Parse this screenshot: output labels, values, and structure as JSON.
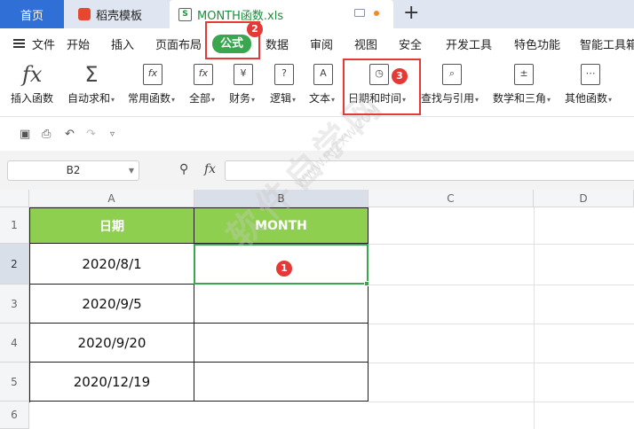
{
  "tabs": {
    "home": "首页",
    "template": "稻壳模板",
    "file": "MONTH函数.xls",
    "file_icon_letter": "S"
  },
  "menu": {
    "file": "文件",
    "items": [
      "开始",
      "插入",
      "页面布局",
      "公式",
      "数据",
      "审阅",
      "视图",
      "安全",
      "开发工具",
      "特色功能",
      "智能工具箱"
    ],
    "active": "公式"
  },
  "ribbon": {
    "insert_function": "插入函数",
    "autosum": "自动求和",
    "common": "常用函数",
    "all": "全部",
    "finance": "财务",
    "logic": "逻辑",
    "text": "文本",
    "datetime": "日期和时间",
    "lookup": "查找与引用",
    "math": "数学和三角",
    "other": "其他函数"
  },
  "formula_bar": {
    "name_box": "B2",
    "fx": "fx",
    "value": ""
  },
  "sheet": {
    "columns": [
      "A",
      "B",
      "C",
      "D"
    ],
    "rows": [
      "1",
      "2",
      "3",
      "4",
      "5",
      "6"
    ],
    "header": [
      "日期",
      "MONTH"
    ],
    "dates": [
      "2020/8/1",
      "2020/9/5",
      "2020/9/20",
      "2020/12/19"
    ],
    "month_values": [
      "",
      "",
      "",
      ""
    ],
    "selected_cell": "B2"
  },
  "annotations": {
    "step1": "1",
    "step2": "2",
    "step3": "3",
    "accent": "#e53935"
  },
  "colors": {
    "header_fill": "#8fcf4f",
    "active_tab": "#3aa64f",
    "home_tab": "#2f6fd6"
  }
}
